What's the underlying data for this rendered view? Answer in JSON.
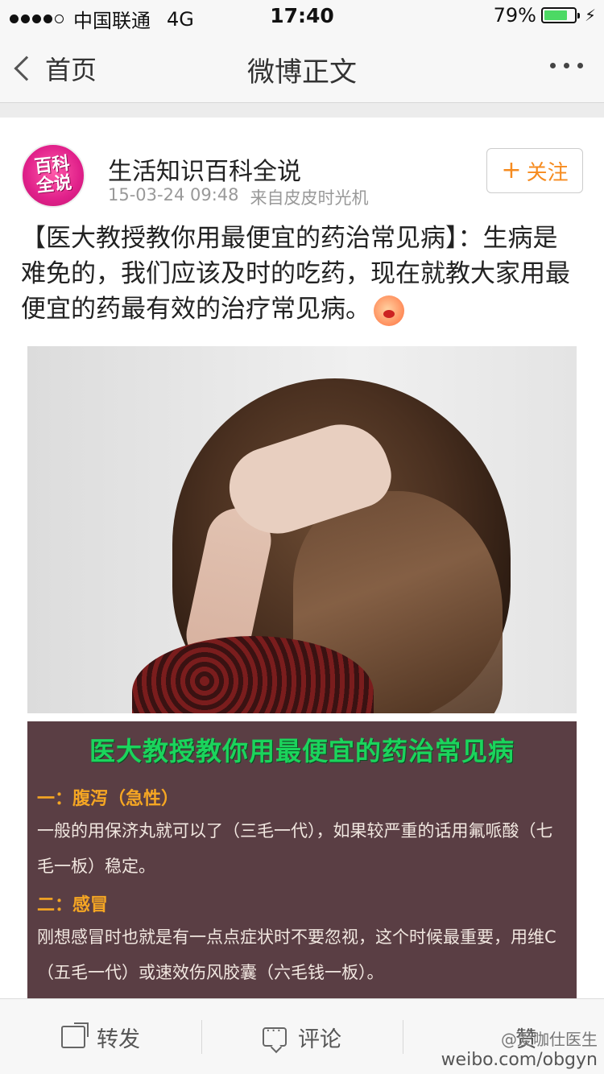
{
  "status_bar": {
    "carrier": "中国联通",
    "network": "4G",
    "time": "17:40",
    "battery": "79%",
    "battery_level": 0.79,
    "battery_color": "#4cd964"
  },
  "nav": {
    "back_label": "首页",
    "title": "微博正文",
    "more_icon": "more-dots-icon"
  },
  "post": {
    "author": "生活知识百科全说",
    "avatar_text": "百科全说",
    "timestamp": "15-03-24 09:48",
    "source": "来自皮皮时光机",
    "follow_label": "关注",
    "follow_color": "#f68b1f",
    "text": "【医大教授教你用最便宜的药治常见病】：生病是难免的，我们应该及时的吃药，现在就教大家用最便宜的药最有效的治疗常见病。"
  },
  "info_image": {
    "title": "医大教授教你用最便宜的药治常见病",
    "title_color": "#1bd45c",
    "section1_heading": "一：腹泻（急性）",
    "section1_text": "一般的用保济丸就可以了（三毛一代），如果较严重的话用氟哌酸（七毛一板）稳定。",
    "section2_heading": "二：感冒",
    "section2_text": "刚想感冒时也就是有一点点症状时不要忽视，这个时候最重要，用维C（五毛一代）或速效伤风胶囊（六毛钱一板）。"
  },
  "toolbar": {
    "repost_label": "转发",
    "comment_label": "评论",
    "like_label": "赞"
  },
  "watermark": {
    "line1": "@爱咖仕医生",
    "line2": "weibo.com/obgyn"
  }
}
